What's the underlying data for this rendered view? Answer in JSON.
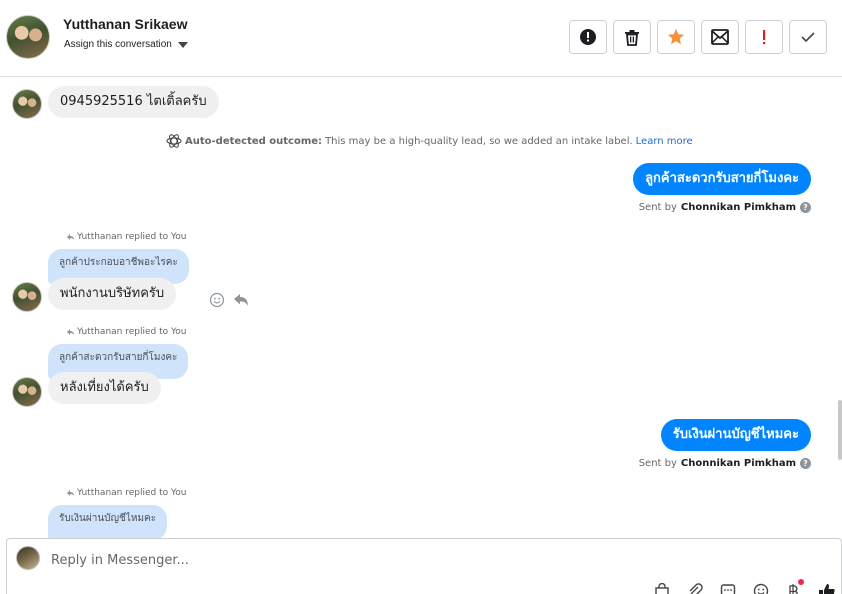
{
  "header": {
    "contact_name": "Yutthanan Srikaew",
    "assign_label": "Assign this conversation",
    "actions": [
      {
        "icon": "alert-circle-icon",
        "name": "mark-spam-button"
      },
      {
        "icon": "trash-icon",
        "name": "delete-button"
      },
      {
        "icon": "star-icon",
        "name": "star-button",
        "color": "#f7923a"
      },
      {
        "icon": "mark-unread-icon",
        "name": "mark-unread-button"
      },
      {
        "icon": "exclamation-icon",
        "name": "follow-up-button",
        "color": "#e02020"
      },
      {
        "icon": "check-icon",
        "name": "done-button"
      }
    ]
  },
  "messages": {
    "m1": {
      "text": "0945925516 ไตเติ้ลครับ"
    },
    "outcome": {
      "label": "Auto-detected outcome:",
      "text": "This may be a high-quality lead, so we added an intake label.",
      "link": "Learn more"
    },
    "m2": {
      "text": "ลูกค้าสะดวกรับสายกี่โมงคะ",
      "sent_by_prefix": "Sent by",
      "sender": "Chonnikan Pimkham"
    },
    "m3": {
      "replied": "Yutthanan replied to You",
      "quote": "ลูกค้าประกอบอาชีพอะไรคะ",
      "text": "พนักงานบริษัทครับ"
    },
    "m4": {
      "replied": "Yutthanan replied to You",
      "quote": "ลูกค้าสะดวกรับสายกี่โมงคะ",
      "text": "หลังเที่ยงได้ครับ"
    },
    "m5": {
      "text": "รับเงินผ่านบัญชีไหมคะ",
      "sent_by_prefix": "Sent by",
      "sender": "Chonnikan Pimkham"
    },
    "m6": {
      "replied": "Yutthanan replied to You",
      "quote": "รับเงินผ่านบัญชีไหมคะ"
    }
  },
  "composer": {
    "placeholder": "Reply in Messenger...",
    "tools": [
      "shopping-bag-icon",
      "paperclip-icon",
      "saved-reply-icon",
      "emoji-icon",
      "payment-icon",
      "thumbs-up-icon"
    ]
  },
  "colors": {
    "outgoing": "#0084ff",
    "incoming": "#f0f0f0",
    "quote": "#cfe3fb",
    "link": "#1a6ed8"
  }
}
